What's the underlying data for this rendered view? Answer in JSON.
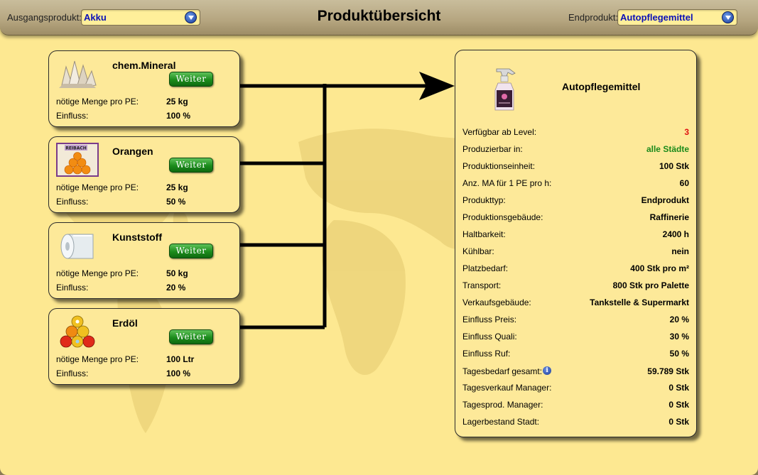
{
  "header": {
    "source_label": "Ausgangsprodukt:",
    "source_value": "Akku",
    "title": "Produktübersicht",
    "end_label": "Endprodukt:",
    "end_value": "Autopflegemittel"
  },
  "weiter_label": "Weiter",
  "sources": [
    {
      "name": "chem.Mineral",
      "icon": "mineral-crystal-icon",
      "qty_label": "nötige Menge pro PE:",
      "qty": "25 kg",
      "influence_label": "Einfluss:",
      "influence": "100 %"
    },
    {
      "name": "Orangen",
      "icon": "orange-crate-icon",
      "qty_label": "nötige Menge pro PE:",
      "qty": "25 kg",
      "influence_label": "Einfluss:",
      "influence": "50 %",
      "crate_text": "REIBACH"
    },
    {
      "name": "Kunststoff",
      "icon": "plastic-roll-icon",
      "qty_label": "nötige Menge pro PE:",
      "qty": "50 kg",
      "influence_label": "Einfluss:",
      "influence": "20 %"
    },
    {
      "name": "Erdöl",
      "icon": "oil-barrels-icon",
      "qty_label": "nötige Menge pro PE:",
      "qty": "100 Ltr",
      "influence_label": "Einfluss:",
      "influence": "100 %"
    }
  ],
  "end_product": {
    "name": "Autopflegemittel",
    "icon": "spray-bottle-icon",
    "properties": [
      {
        "label": "Verfügbar ab Level:",
        "value": "3",
        "color": "#e01010"
      },
      {
        "label": "Produzierbar in:",
        "value": "alle Städte",
        "color": "#1a8a1a"
      },
      {
        "label": "Produktionseinheit:",
        "value": "100 Stk"
      },
      {
        "label": "Anz. MA für 1 PE pro h:",
        "value": "60"
      },
      {
        "label": "Produkttyp:",
        "value": "Endprodukt"
      },
      {
        "label": "Produktionsgebäude:",
        "value": "Raffinerie"
      },
      {
        "label": "Haltbarkeit:",
        "value": "2400 h"
      },
      {
        "label": "Kühlbar:",
        "value": "nein"
      },
      {
        "label": "Platzbedarf:",
        "value": "400 Stk pro m²"
      },
      {
        "label": "Transport:",
        "value": "800 Stk pro Palette"
      },
      {
        "label": "Verkaufsgebäude:",
        "value": "Tankstelle & Supermarkt"
      },
      {
        "label": "Einfluss Preis:",
        "value": "20 %"
      },
      {
        "label": "Einfluss Quali:",
        "value": "30 %"
      },
      {
        "label": "Einfluss Ruf:",
        "value": "50 %"
      },
      {
        "label": "Tagesbedarf gesamt:",
        "value": "59.789 Stk",
        "info": true
      },
      {
        "label": "Tagesverkauf Manager:",
        "value": "0 Stk"
      },
      {
        "label": "Tagesprod. Manager:",
        "value": "0 Stk"
      },
      {
        "label": "Lagerbestand Stadt:",
        "value": "0 Stk"
      }
    ]
  },
  "colors": {
    "background": "#fde891",
    "select_text": "#0a10b8",
    "button_green": "#1c8c1c"
  }
}
